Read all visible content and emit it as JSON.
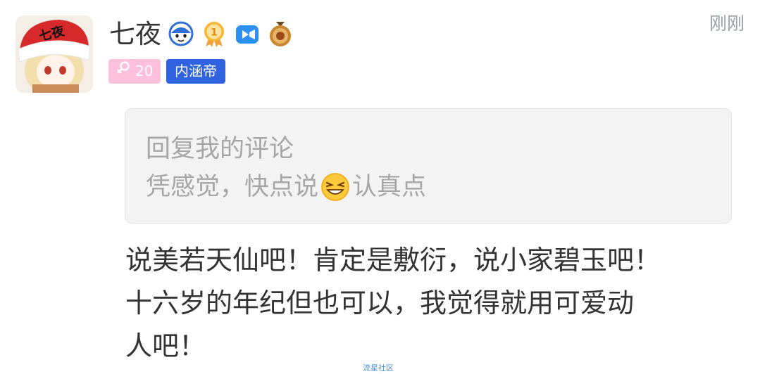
{
  "user": {
    "name": "七夜",
    "avatar_text": "七夜",
    "badges": [
      "vip-face-icon",
      "rank-1-medal-icon",
      "video-creator-icon",
      "bronze-medal-icon"
    ],
    "gender_tag": {
      "icon": "female-symbol-icon",
      "value": "20"
    },
    "title_tag": "内涵帝"
  },
  "timestamp": "刚刚",
  "quoted_comment": {
    "line1": "回复我的评论",
    "line2_before_emoji": "凭感觉，快点说",
    "emoji": "grin-emoji",
    "line2_after_emoji": "认真点"
  },
  "reply": {
    "lines": [
      "说美若天仙吧！肯定是敷衍，说小家碧玉吧！",
      "十六岁的年纪但也可以，我觉得就用可爱动",
      "人吧！"
    ]
  },
  "watermark": "流星社区",
  "colors": {
    "title_tag": "#2f63e0",
    "gender_tag": "#ffc0dc",
    "quote_bg": "#f3f3f3",
    "text": "#333333",
    "muted": "#a6a6a6"
  }
}
